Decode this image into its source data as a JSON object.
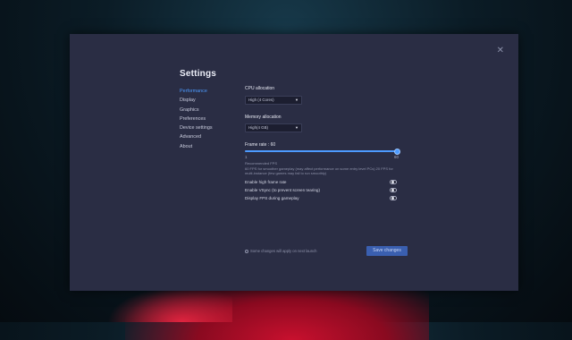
{
  "window": {
    "title": "Settings",
    "close_label": "✕"
  },
  "sidebar": {
    "items": [
      {
        "label": "Performance",
        "active": true
      },
      {
        "label": "Display"
      },
      {
        "label": "Graphics"
      },
      {
        "label": "Preferences"
      },
      {
        "label": "Device settings"
      },
      {
        "label": "Advanced"
      },
      {
        "label": "About"
      }
    ]
  },
  "cpu": {
    "label": "CPU allocation",
    "value": "High (4 Cores)"
  },
  "memory": {
    "label": "Memory allocation",
    "value": "High(4 GB)"
  },
  "frame_rate": {
    "label": "Frame rate : 60",
    "min_label": "1",
    "max_label": "60",
    "value": 60,
    "min": 1,
    "max": 60
  },
  "recommended": {
    "title": "Recommended FPS",
    "text": "60 FPS for smoother gameplay (may affect performance on some entry level PCs) 20 FPS for multi-instance (few games may fail to run smoothly)"
  },
  "toggles": [
    {
      "label": "Enable high frame rate",
      "on": false
    },
    {
      "label": "Enable VSync (to prevent screen tearing)",
      "on": false
    },
    {
      "label": "Display FPS during gameplay",
      "on": false
    }
  ],
  "footer": {
    "note": "Some changes will apply on next launch",
    "save_label": "Save changes"
  },
  "colors": {
    "accent": "#4d9bff",
    "window_bg": "#2a2d44",
    "button_bg": "#3a5fb0"
  }
}
